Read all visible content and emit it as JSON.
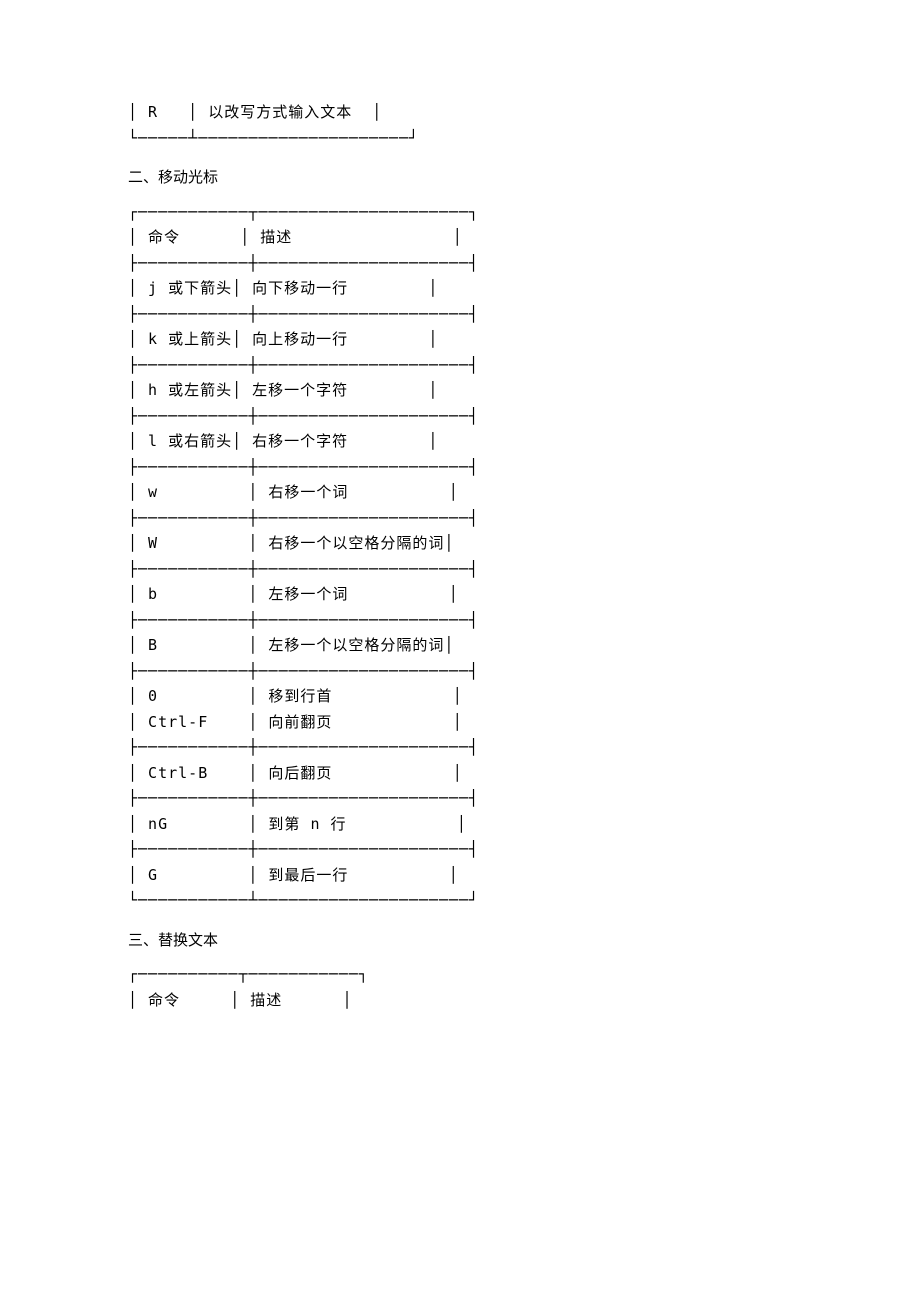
{
  "table1": {
    "rows": [
      {
        "cmd": "R",
        "desc": "以改写方式输入文本"
      }
    ]
  },
  "section2": {
    "heading": "二、移动光标",
    "header": {
      "cmd": "命令",
      "desc": "描述"
    },
    "rows": [
      {
        "cmd": "j 或下箭头",
        "desc": "向下移动一行"
      },
      {
        "cmd": "k 或上箭头",
        "desc": "向上移动一行"
      },
      {
        "cmd": "h 或左箭头",
        "desc": "左移一个字符"
      },
      {
        "cmd": "l 或右箭头",
        "desc": "右移一个字符"
      },
      {
        "cmd": "w",
        "desc": "右移一个词"
      },
      {
        "cmd": "W",
        "desc": "右移一个以空格分隔的词"
      },
      {
        "cmd": "b",
        "desc": "左移一个词"
      },
      {
        "cmd": "B",
        "desc": "左移一个以空格分隔的词"
      },
      {
        "cmd": "0",
        "desc": "移到行首"
      },
      {
        "cmd": "Ctrl-F",
        "desc": "向前翻页"
      },
      {
        "cmd": "Ctrl-B",
        "desc": "向后翻页"
      },
      {
        "cmd": "nG",
        "desc": "到第 n 行"
      },
      {
        "cmd": "G",
        "desc": "到最后一行"
      }
    ]
  },
  "section3": {
    "heading": "三、替换文本",
    "header": {
      "cmd": "命令",
      "desc": "描述"
    }
  },
  "box": {
    "vbar": "│",
    "tl": "┌",
    "tr": "┐",
    "bl": "└",
    "br": "┘",
    "ml": "├",
    "mr": "┤",
    "tt": "┬",
    "tb": "┴",
    "cross": "┼",
    "h": "─"
  }
}
